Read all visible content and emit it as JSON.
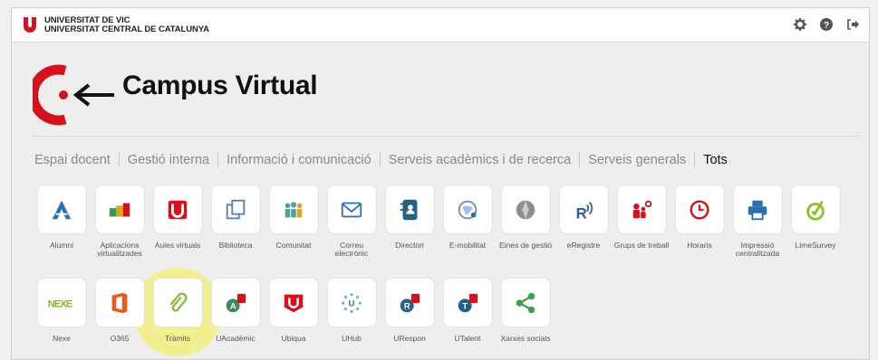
{
  "header": {
    "org_line1": "UNIVERSITAT DE VIC",
    "org_line2": "UNIVERSITAT CENTRAL DE CATALUNYA",
    "icons": [
      "gear-icon",
      "help-icon",
      "logout-icon"
    ]
  },
  "logo": {
    "title": "Campus Virtual"
  },
  "colors": {
    "brand": "#d4121e",
    "active_menu": "#111111",
    "menu": "#8a8a8a"
  },
  "menu": [
    {
      "label": "Espai docent",
      "active": false
    },
    {
      "label": "Gestió interna",
      "active": false
    },
    {
      "label": "Informació i comunicació",
      "active": false
    },
    {
      "label": "Serveis acadèmics i de recerca",
      "active": false
    },
    {
      "label": "Serveis generals",
      "active": false
    },
    {
      "label": "Tots",
      "active": true
    }
  ],
  "apps": {
    "row1": [
      {
        "label": "Alumni",
        "icon": "alumni-icon"
      },
      {
        "label": "Aplicacions virtualitzades",
        "icon": "apps-icon"
      },
      {
        "label": "Aules virtuals",
        "icon": "aules-icon"
      },
      {
        "label": "Biblioteca",
        "icon": "library-icon"
      },
      {
        "label": "Comunitat",
        "icon": "community-icon"
      },
      {
        "label": "Correu electrònic",
        "icon": "mail-icon"
      },
      {
        "label": "Directori",
        "icon": "directory-icon"
      },
      {
        "label": "E-mobilitat",
        "icon": "mobility-icon"
      },
      {
        "label": "Eines de gestió",
        "icon": "tools-icon"
      },
      {
        "label": "eRegistre",
        "icon": "eregistre-icon"
      },
      {
        "label": "Grups de treball",
        "icon": "workgroups-icon"
      },
      {
        "label": "Horaris",
        "icon": "clock-icon"
      },
      {
        "label": "Impressió centralitzada",
        "icon": "printer-icon"
      },
      {
        "label": "LimeSurvey",
        "icon": "limesurvey-icon"
      }
    ],
    "row2": [
      {
        "label": "Nexe",
        "icon": "nexe-icon"
      },
      {
        "label": "O365",
        "icon": "office-icon"
      },
      {
        "label": "Tràmits",
        "icon": "paperclip-icon"
      },
      {
        "label": "UAcadèmic",
        "icon": "uacademic-icon"
      },
      {
        "label": "Ubiqua",
        "icon": "ubiqua-icon"
      },
      {
        "label": "UHub",
        "icon": "uhub-icon"
      },
      {
        "label": "URespon",
        "icon": "urespon-icon"
      },
      {
        "label": "UTalent",
        "icon": "utalent-icon"
      },
      {
        "label": "Xarxes socials",
        "icon": "share-icon"
      }
    ]
  }
}
